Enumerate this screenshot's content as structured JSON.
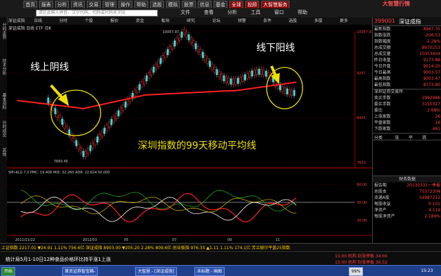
{
  "menubar": {
    "items": [
      "首页",
      "报表",
      "分析",
      "资讯",
      "交易",
      "管理",
      "操作",
      "帮助",
      "选股",
      "模拟",
      "股票",
      "信息",
      "基金",
      "全球",
      "投顾",
      "大智慧服务"
    ],
    "app_title": "大智慧行情"
  },
  "toolbar": {
    "search_placeholder": "请在此输入拼音、汉字代码、代码或代码名字段",
    "items": [
      "文件",
      "查看",
      "分析",
      "工具",
      "窗口",
      "帮助"
    ]
  },
  "tabs": [
    "深证成指",
    "日线",
    "分时",
    "个股",
    "报价",
    "资金",
    "板块",
    "研究",
    "论坛",
    "预警",
    "条件",
    "选股",
    "多股",
    "更多"
  ],
  "left_tabs": [
    "分时走势",
    "技术分析",
    "基本资料",
    "分时成交",
    "其他"
  ],
  "chart": {
    "header": "深证成指 日线 ETF 日K",
    "annotations": {
      "left": "线上阴线",
      "right": "线下阳线",
      "center": "深圳指数的99天移动平均线"
    },
    "price_ticks": [
      "10057.97",
      "9257",
      "8455",
      "7653"
    ],
    "high_label": "10057.97",
    "low_label": "7660.45",
    "indicator_header": "SMI-KLG 7.0  PMC: 19.406  MDI: 32.260  ADR: 22.824  50.000",
    "indicator_ticks": [
      "80.00",
      "50.00",
      "20.00"
    ],
    "date_labels": [
      "2011/11/22",
      "2012/03",
      "05",
      "07",
      "09",
      "11"
    ]
  },
  "right_panel": {
    "code": "399001",
    "name": "深证成指",
    "quote_rows": [
      {
        "label": "最新指数",
        "value": "8967.35"
      },
      {
        "label": "指数涨跌",
        "value": "-206.53"
      },
      {
        "label": "指数幅度",
        "value": "-2.28%"
      },
      {
        "label": "总成交额",
        "value": "8970253"
      },
      {
        "label": "总成交量",
        "value": "10353404"
      },
      {
        "label": "昨日收盘",
        "value": "9173.88"
      },
      {
        "label": "今日开盘",
        "value": "9014.20"
      },
      {
        "label": "今日最高",
        "value": "9003.57"
      },
      {
        "label": "最高指数",
        "value": "9003.47"
      },
      {
        "label": "最低指数",
        "value": "8773.80"
      }
    ],
    "exchange": "深圳证券交易所",
    "trade_rows": [
      {
        "label": "卖买手数",
        "value": "2992986"
      },
      {
        "label": "委买手数",
        "value": "3150327"
      },
      {
        "label": "委比",
        "value": "2.68%"
      },
      {
        "label": "上涨家数",
        "value": "26"
      },
      {
        "label": "平盘家数",
        "value": "16"
      },
      {
        "label": "下跌家数",
        "value": "461"
      }
    ],
    "table_header": [
      "分类",
      "涨",
      "平",
      "跌"
    ],
    "finance_title": "财务数据",
    "finance_rows": [
      {
        "label": "报告期",
        "value": "20130331一季报"
      },
      {
        "label": "总股本",
        "value": "75572304"
      },
      {
        "label": "流通A股",
        "value": "54987212"
      },
      {
        "label": "每股收益",
        "value": "0.101"
      },
      {
        "label": "净资产",
        "value": "4.119"
      },
      {
        "label": "每股净资产",
        "value": "2.189%"
      }
    ]
  },
  "statusbar": {
    "text": "上证指数 2217.01 ▼24.91 1.11% 756.6亿 深证成指 8903.00 ▼205.20 2.28% 809.6亿 创业板指 976.33 ▲1.11 1.11% 174.1亿 芳兰赫尔平盖25指数",
    "news": "统计局5月1-10日12种食品价格环比持平涨1上涨",
    "extra1": "15:00 机构 封涨停板 34.00",
    "extra2": "15:00 机构 封涨停板 36.52"
  },
  "taskbar": {
    "start": "开始",
    "items": [
      "首页证券智宝箱-",
      "大智慧 - [深证成指]",
      "未标题 - 画图"
    ],
    "zoom": "99%",
    "clock": "15:23"
  }
}
